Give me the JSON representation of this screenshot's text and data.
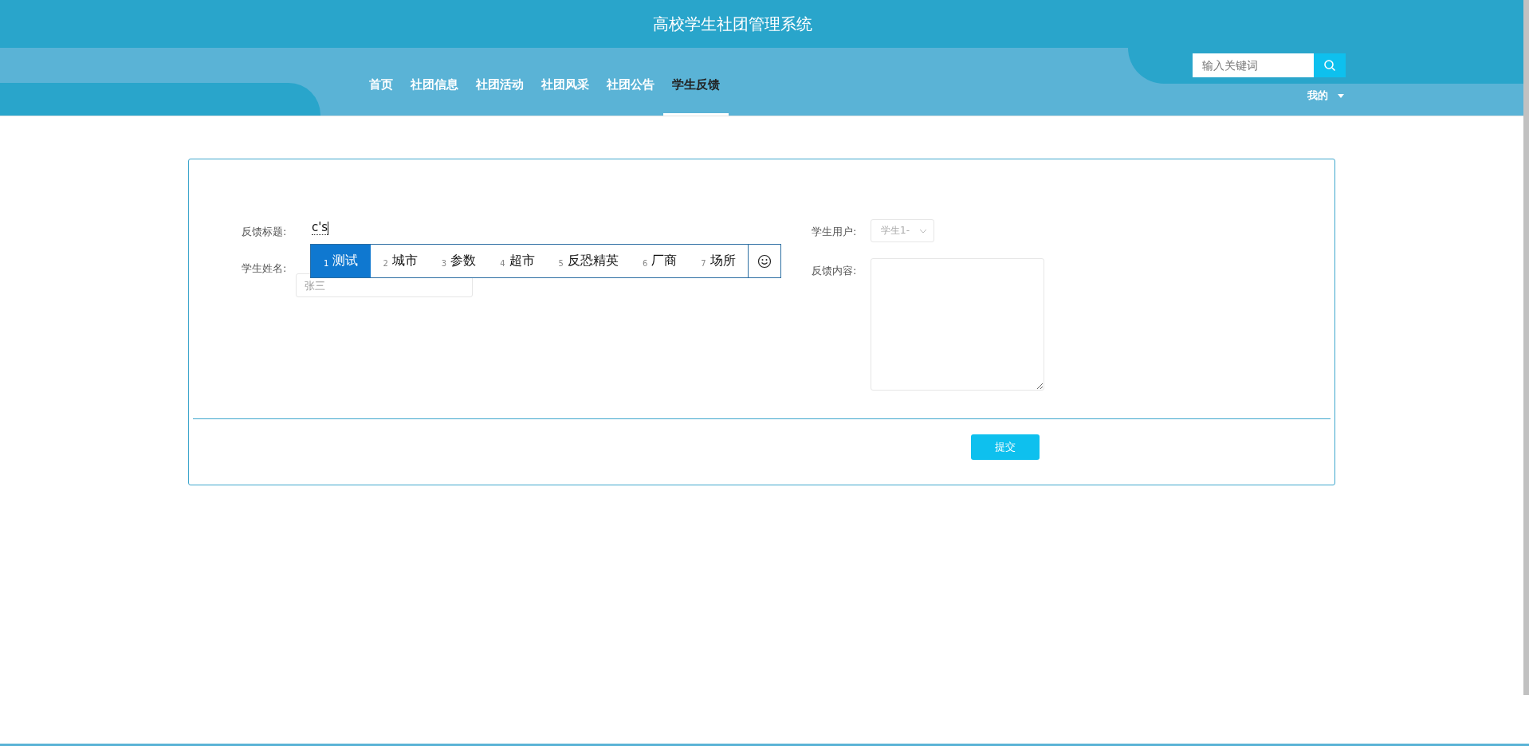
{
  "header": {
    "title": "高校学生社团管理系统"
  },
  "nav": [
    {
      "label": "首页",
      "selected": false
    },
    {
      "label": "社团信息",
      "selected": false
    },
    {
      "label": "社团活动",
      "selected": false
    },
    {
      "label": "社团风采",
      "selected": false
    },
    {
      "label": "社团公告",
      "selected": false
    },
    {
      "label": "学生反馈",
      "selected": true
    }
  ],
  "search": {
    "placeholder": "输入关键词"
  },
  "user_menu": {
    "label": "我的"
  },
  "form": {
    "left": [
      {
        "label": "反馈标题:",
        "value": "c's"
      },
      {
        "label": "学生姓名:",
        "placeholder": "张三"
      }
    ],
    "right": [
      {
        "label": "学生用户:",
        "kind": "select",
        "value": "学生1-"
      },
      {
        "label": "反馈内容:",
        "kind": "textarea"
      }
    ],
    "submit": "提交"
  },
  "ime": {
    "candidates": [
      {
        "index": "1",
        "text": "测试",
        "selected": true
      },
      {
        "index": "2",
        "text": "城市",
        "selected": false
      },
      {
        "index": "3",
        "text": "参数",
        "selected": false
      },
      {
        "index": "4",
        "text": "超市",
        "selected": false
      },
      {
        "index": "5",
        "text": "反恐精英",
        "selected": false
      },
      {
        "index": "6",
        "text": "厂商",
        "selected": false
      },
      {
        "index": "7",
        "text": "场所",
        "selected": false
      }
    ]
  }
}
